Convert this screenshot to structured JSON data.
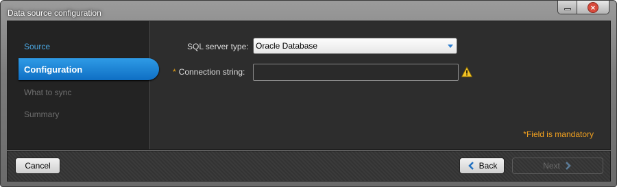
{
  "window": {
    "title": "Data source configuration",
    "controls": {
      "minimize_icon": "minimize-icon",
      "close_icon": "close-icon",
      "close_glyph": "×"
    }
  },
  "sidebar": {
    "items": [
      {
        "label": "Source",
        "state": "done"
      },
      {
        "label": "Configuration",
        "state": "active"
      },
      {
        "label": "What to sync",
        "state": "pending"
      },
      {
        "label": "Summary",
        "state": "pending"
      }
    ]
  },
  "form": {
    "sql_server_type": {
      "label": "SQL server type:",
      "value": "Oracle Database"
    },
    "connection_string": {
      "required_mark": "*",
      "label": "Connection string:",
      "value": ""
    },
    "warning_icon": "warning-icon",
    "mandatory_note": "*Field is mandatory"
  },
  "footer": {
    "cancel_label": "Cancel",
    "back_label": "Back",
    "next_label": "Next"
  },
  "colors": {
    "accent": "#1a82d6",
    "done_link": "#4aa6e0",
    "mandatory": "#f0a020",
    "panel_bg": "#2d2d2d"
  }
}
